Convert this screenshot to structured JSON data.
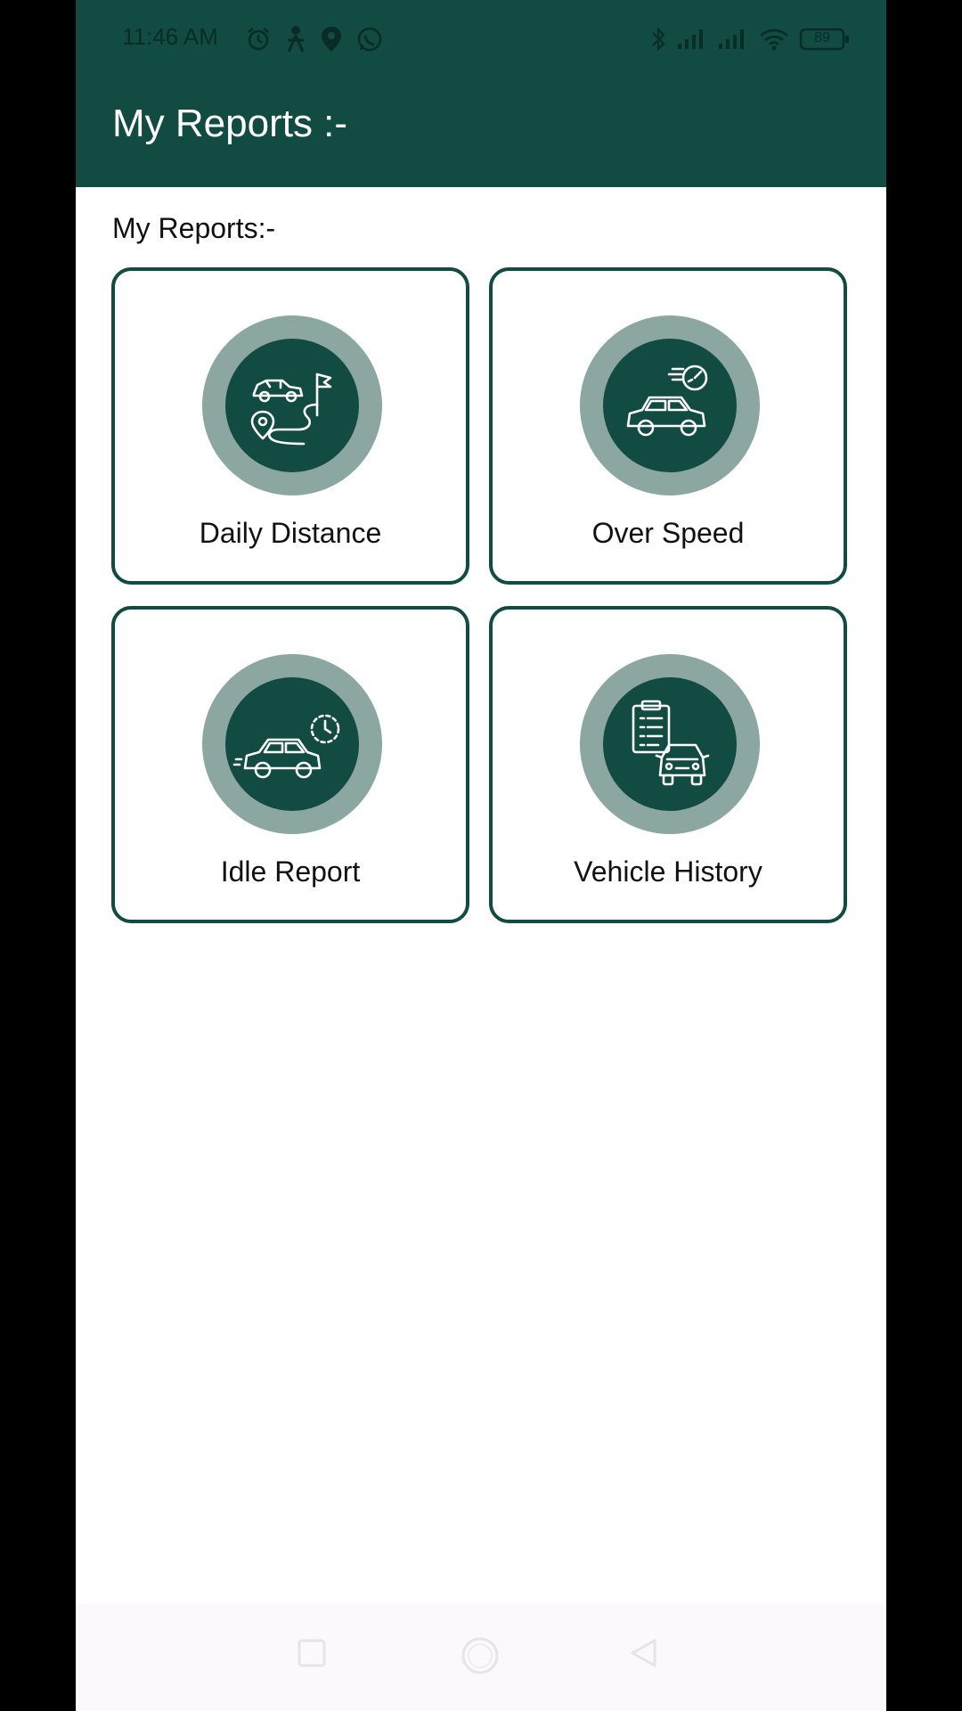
{
  "status_bar": {
    "time": "11:46 AM",
    "battery": "89",
    "left_icons": [
      "alarm-icon",
      "person-icon",
      "location-pin-icon",
      "whatsapp-icon"
    ],
    "right_icons": [
      "bluetooth-icon",
      "signal-icon",
      "signal-icon",
      "wifi-icon",
      "battery-icon"
    ]
  },
  "toolbar": {
    "title": "My Reports :-"
  },
  "section": {
    "label": "My Reports:-"
  },
  "cards": [
    {
      "label": "Daily Distance",
      "icon": "car-route-flag-icon"
    },
    {
      "label": "Over Speed",
      "icon": "car-speedometer-icon"
    },
    {
      "label": "Idle Report",
      "icon": "car-clock-icon"
    },
    {
      "label": "Vehicle History",
      "icon": "car-clipboard-icon"
    }
  ],
  "colors": {
    "primary": "#114b42",
    "icon_ring": "#8ca7a1",
    "background": "#ffffff",
    "nav_bar": "#fbf9fc"
  },
  "nav_bar": {
    "buttons": [
      "recents-square-icon",
      "home-circle-icon",
      "back-triangle-icon"
    ]
  }
}
